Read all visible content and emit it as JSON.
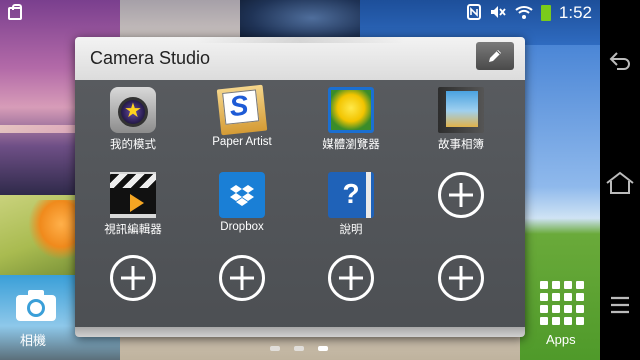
{
  "status_bar": {
    "time": "1:52",
    "icons": [
      "shopping-bag-icon",
      "nfc-icon",
      "mute-icon",
      "wifi-icon",
      "battery-icon"
    ],
    "battery_color": "#7acb1b"
  },
  "folder": {
    "title": "Camera Studio",
    "edit_icon": "pencil-icon",
    "apps": [
      {
        "label": "我的模式",
        "icon": "my-mode-camera-icon"
      },
      {
        "label": "Paper Artist",
        "icon": "paper-artist-icon"
      },
      {
        "label": "媒體瀏覽器",
        "icon": "media-browser-icon"
      },
      {
        "label": "故事相簿",
        "icon": "story-album-icon"
      },
      {
        "label": "視訊編輯器",
        "icon": "video-editor-icon"
      },
      {
        "label": "Dropbox",
        "icon": "dropbox-icon"
      },
      {
        "label": "說明",
        "icon": "help-icon"
      }
    ],
    "empty_slots": 5,
    "add_icon": "add-circle-icon"
  },
  "home": {
    "page_count": 3,
    "active_page": 3
  },
  "dock": {
    "camera_label": "相機",
    "apps_label": "Apps"
  },
  "nav": {
    "buttons": [
      "back-icon",
      "home-icon",
      "menu-icon"
    ]
  }
}
